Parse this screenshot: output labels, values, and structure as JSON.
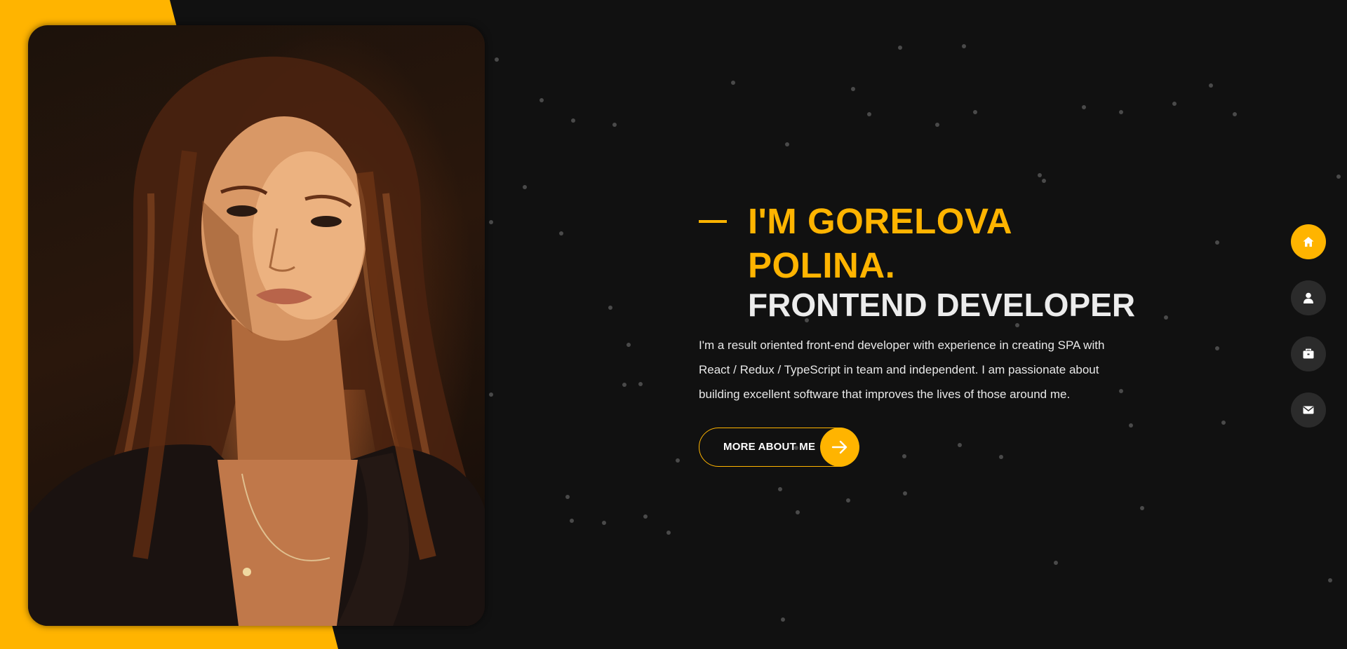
{
  "hero": {
    "title_name": "I'M GORELOVA POLINA.",
    "title_role": "FRONTEND DEVELOPER",
    "intro": "I'm a result oriented front-end developer with experience in creating SPA with React / Redux / TypeScript in team and independent. I am passionate about building excellent software that improves the lives of those around me.",
    "button_label": "MORE ABOUT ME",
    "button_icon": "arrow-right-icon"
  },
  "side_nav": {
    "items": [
      {
        "name": "home",
        "icon": "home-icon",
        "active": true
      },
      {
        "name": "about",
        "icon": "user-icon",
        "active": false
      },
      {
        "name": "portfolio",
        "icon": "briefcase-icon",
        "active": false
      },
      {
        "name": "contact",
        "icon": "envelope-icon",
        "active": false
      }
    ]
  },
  "colors": {
    "accent": "#ffb400",
    "background": "#111111",
    "nav_button": "#2b2b2b",
    "text": "#e8e8e8"
  }
}
